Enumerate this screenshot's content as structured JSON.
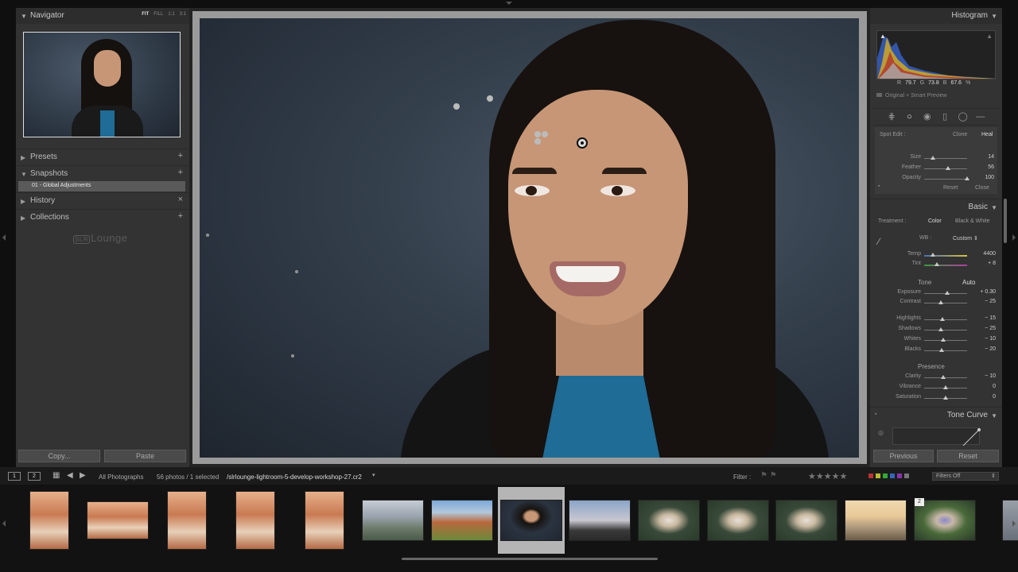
{
  "left_panel": {
    "navigator": {
      "title": "Navigator",
      "zoom_options": [
        "FIT",
        "FILL",
        "1:1",
        "3:1"
      ]
    },
    "presets": {
      "title": "Presets",
      "action": "+"
    },
    "snapshots": {
      "title": "Snapshots",
      "action": "+",
      "items": [
        "01 - Global Adjustments"
      ]
    },
    "history": {
      "title": "History",
      "action": "×"
    },
    "collections": {
      "title": "Collections",
      "action": "+"
    },
    "logo": {
      "prefix": "SLR",
      "name": "Lounge"
    },
    "copy_label": "Copy...",
    "paste_label": "Paste"
  },
  "right_panel": {
    "histogram": {
      "title": "Histogram",
      "r_label": "R",
      "r_value": "79.7",
      "g_label": "G",
      "g_value": "73.8",
      "b_label": "B",
      "b_value": "67.6",
      "unit": "%",
      "caption": "Original + Smart Preview"
    },
    "spot": {
      "label": "Spot Edit :",
      "clone": "Clone",
      "heal": "Heal",
      "sliders": [
        {
          "label": "Size",
          "value": "14",
          "pos": 0.2
        },
        {
          "label": "Feather",
          "value": "56",
          "pos": 0.56
        },
        {
          "label": "Opacity",
          "value": "100",
          "pos": 1.0
        }
      ],
      "reset": "Reset",
      "close": "Close"
    },
    "basic": {
      "title": "Basic",
      "treatment_label": "Treatment :",
      "color": "Color",
      "bw": "Black & White",
      "wb_label": "WB :",
      "wb_value": "Custom",
      "temp_tint": [
        {
          "label": "Temp",
          "value": "4400",
          "pos": 0.2
        },
        {
          "label": "Tint",
          "value": "+ 8",
          "pos": 0.3
        }
      ],
      "tone_label": "Tone",
      "auto_label": "Auto",
      "tone_sliders": [
        {
          "label": "Exposure",
          "value": "+ 0.30",
          "pos": 0.53
        },
        {
          "label": "Contrast",
          "value": "− 25",
          "pos": 0.38
        }
      ],
      "tone_sliders2": [
        {
          "label": "Highlights",
          "value": "− 15",
          "pos": 0.43
        },
        {
          "label": "Shadows",
          "value": "− 25",
          "pos": 0.38
        },
        {
          "label": "Whites",
          "value": "− 10",
          "pos": 0.45
        },
        {
          "label": "Blacks",
          "value": "− 20",
          "pos": 0.4
        }
      ],
      "presence_label": "Presence",
      "presence_sliders": [
        {
          "label": "Clarity",
          "value": "− 10",
          "pos": 0.45
        },
        {
          "label": "Vibrance",
          "value": "0",
          "pos": 0.5
        },
        {
          "label": "Saturation",
          "value": "0",
          "pos": 0.5
        }
      ]
    },
    "tone_curve": {
      "title": "Tone Curve"
    },
    "previous_label": "Previous",
    "reset_label": "Reset"
  },
  "filmstrip_bar": {
    "page1": "1",
    "page2": "2",
    "source": "All Photographs",
    "count": "56 photos / 1 selected",
    "filename": "/slrlounge-lightroom-5-develop-workshop-27.cr2",
    "filter_label": "Filter :",
    "filter_value": "Filters Off",
    "stars": "★★★★★"
  },
  "filmstrip": {
    "badge": "2",
    "thumbs": [
      "canyon",
      "canyon",
      "canyon",
      "canyon",
      "canyon",
      "couple-coast",
      "red-rocks",
      "portrait",
      "couple-sunset",
      "couple-outdoor",
      "couple-outdoor",
      "couple-outdoor",
      "couple-beach",
      "couple-trees",
      "portrait-cut"
    ]
  },
  "colors": {
    "panel": "#333333",
    "accent_blue": "#1f6c96",
    "filmstrip_bg": "#121212"
  }
}
